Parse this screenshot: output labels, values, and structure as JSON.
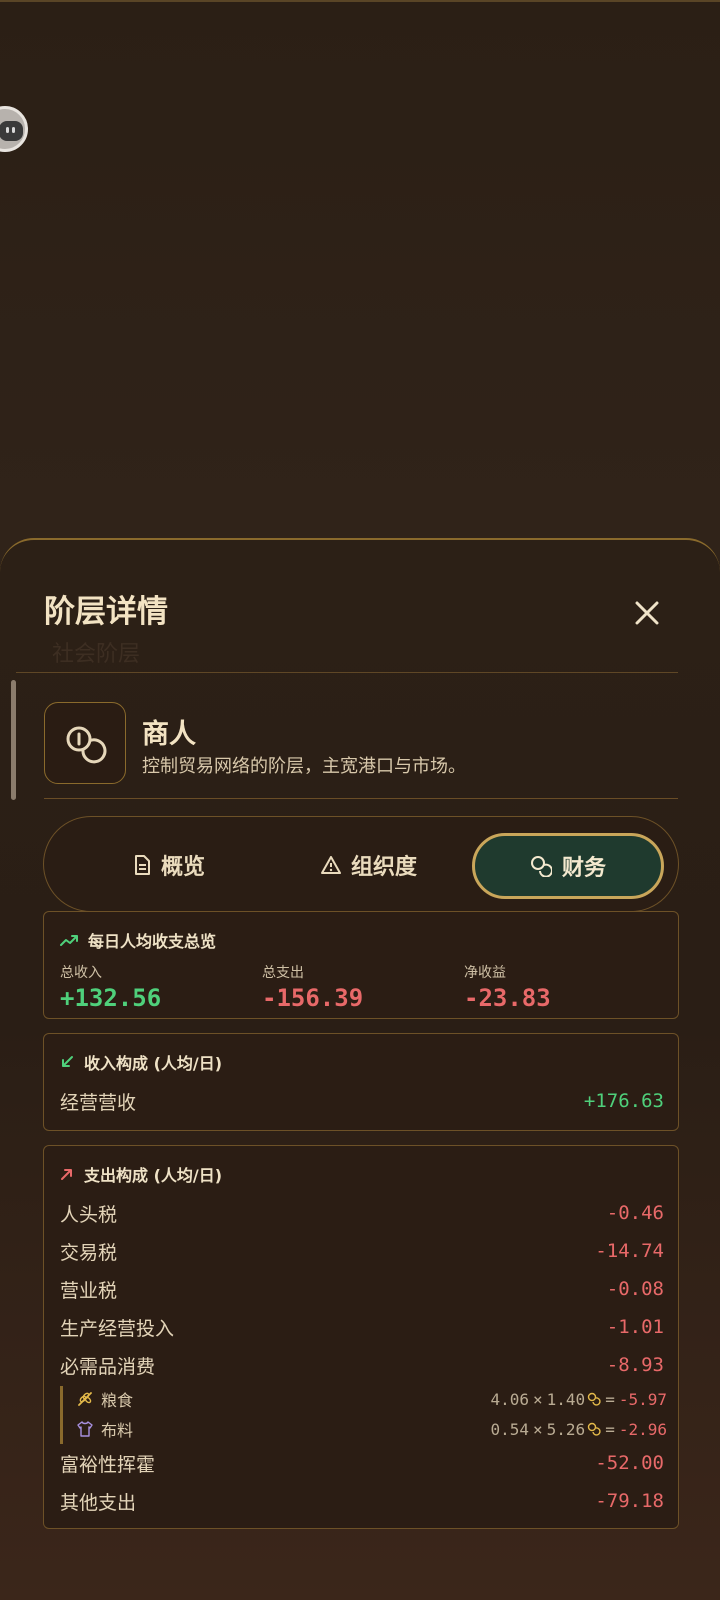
{
  "sheet": {
    "title": "阶层详情",
    "ghost_title": "社会阶层"
  },
  "class_info": {
    "name": "商人",
    "description": "控制贸易网络的阶层，主宽港口与市场。",
    "icon": "coins-icon"
  },
  "tabs": [
    {
      "label": "概览",
      "icon": "document-icon",
      "active": false
    },
    {
      "label": "组织度",
      "icon": "warning-icon",
      "active": false
    },
    {
      "label": "财务",
      "icon": "coins-icon",
      "active": true
    }
  ],
  "summary": {
    "title": "每日人均收支总览",
    "income_label": "总收入",
    "income_value": "+132.56",
    "expense_label": "总支出",
    "expense_value": "-156.39",
    "net_label": "净收益",
    "net_value": "-23.83"
  },
  "income": {
    "title": "收入构成 (人均/日)",
    "items": [
      {
        "label": "经营营收",
        "value": "+176.63"
      }
    ]
  },
  "expense": {
    "title": "支出构成 (人均/日)",
    "items": [
      {
        "label": "人头税",
        "value": "-0.46"
      },
      {
        "label": "交易税",
        "value": "-14.74"
      },
      {
        "label": "营业税",
        "value": "-0.08"
      },
      {
        "label": "生产经营投入",
        "value": "-1.01"
      },
      {
        "label": "必需品消费",
        "value": "-8.93"
      },
      {
        "label": "富裕性挥霍",
        "value": "-52.00"
      },
      {
        "label": "其他支出",
        "value": "-79.18"
      }
    ],
    "necessities": [
      {
        "label": "粮食",
        "icon": "wheat-icon",
        "qty": "4.06",
        "times": "×",
        "price": "1.40",
        "eq": "=",
        "result": "-5.97"
      },
      {
        "label": "布料",
        "icon": "shirt-icon",
        "qty": "0.54",
        "times": "×",
        "price": "5.26",
        "eq": "=",
        "result": "-2.96"
      }
    ]
  },
  "colors": {
    "positive": "#4fd07b",
    "negative": "#e86969",
    "gold": "#c9a65a",
    "active_tab_bg": "#1f3a2e"
  }
}
